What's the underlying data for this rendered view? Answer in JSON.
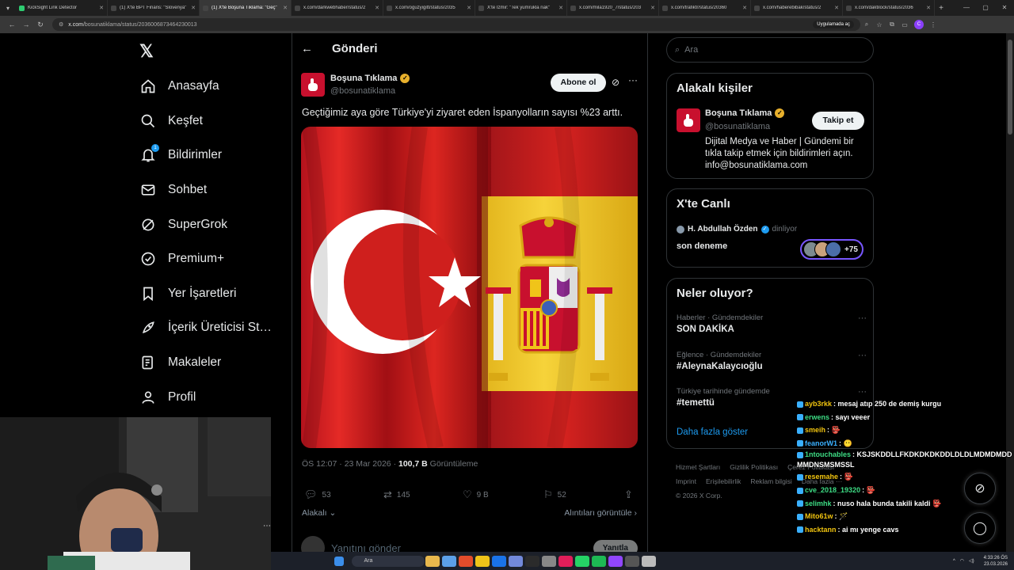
{
  "browser": {
    "tabs": [
      {
        "title": "KickSight Link Detector",
        "color": "#2ecc71"
      },
      {
        "title": "(1) X'te BPT Finans: \"Slovenya\"",
        "color": "#444"
      },
      {
        "title": "(1) X'te Boşuna Tıklama: \"Geç\"",
        "color": "#444",
        "active": true
      },
      {
        "title": "x.com/darkwebhaber/status/2",
        "color": "#444"
      },
      {
        "title": "x.com/oguzyigitt/status/2035",
        "color": "#444"
      },
      {
        "title": "X'te İzmir: \"Tek yumrukla nak\"",
        "color": "#444"
      },
      {
        "title": "x.com/mila1920_7/status/203",
        "color": "#444"
      },
      {
        "title": "x.com/trafiktr/status/20360",
        "color": "#444"
      },
      {
        "title": "x.com/haberebibak/status/2",
        "color": "#444"
      },
      {
        "title": "x.com/daktilock/status/2036",
        "color": "#444"
      }
    ],
    "url_host": "x.com",
    "url_path": "/bosunatiklama/status/2036006873464230013",
    "app_pill": "Uygulamada aç",
    "profile_initial": "C"
  },
  "nav": {
    "items": [
      {
        "label": "Anasayfa",
        "icon": "home-icon"
      },
      {
        "label": "Keşfet",
        "icon": "search-icon"
      },
      {
        "label": "Bildirimler",
        "icon": "bell-icon",
        "badge": "1"
      },
      {
        "label": "Sohbet",
        "icon": "mail-icon"
      },
      {
        "label": "SuperGrok",
        "icon": "grok-icon"
      },
      {
        "label": "Premium+",
        "icon": "verified-icon"
      },
      {
        "label": "Yer İşaretleri",
        "icon": "bookmark-icon"
      },
      {
        "label": "İçerik Üreticisi St…",
        "icon": "rocket-icon"
      },
      {
        "label": "Makaleler",
        "icon": "article-icon"
      },
      {
        "label": "Profil",
        "icon": "person-icon"
      }
    ]
  },
  "post": {
    "header": "Gönderi",
    "author_name": "Boşuna Tıklama",
    "author_handle": "@bosunatiklama",
    "subscribe_label": "Abone ol",
    "text": "Geçtiğimiz aya göre Türkiye'yi ziyaret eden İspanyolların sayısı %23 arttı.",
    "timestamp": "ÖS 12:07 · 23 Mar 2026 · ",
    "views_value": "100,7 B",
    "views_label": " Görüntüleme",
    "replies": "53",
    "reposts": "145",
    "likes": "9 B",
    "bookmarks": "52",
    "relevant_label": "Alakalı",
    "quotes_label": "Alıntıları görüntüle",
    "reply_placeholder": "Yanıtını gönder",
    "reply_button": "Yanıtla"
  },
  "sidebar": {
    "search_placeholder": "Ara",
    "relevant_title": "Alakalı kişiler",
    "rp_name": "Boşuna Tıklama",
    "rp_handle": "@bosunatiklama",
    "follow_label": "Takip et",
    "rp_bio": "Dijital Medya ve Haber | Gündemi bir tıkla takip etmek için bildirimleri açın. info@bosunatiklama.com",
    "live_title": "X'te Canlı",
    "live_host": "H. Abdullah Özden",
    "live_status": "dinliyor",
    "live_space": "son deneme",
    "live_count": "+75",
    "trends_title": "Neler oluyor?",
    "trends": [
      {
        "context": "Haberler · Gündemdekiler",
        "name": "SON DAKİKA"
      },
      {
        "context": "Eğlence · Gündemdekiler",
        "name": "#AleynaKalaycıoğlu"
      },
      {
        "context": "Türkiye tarihinde gündemde",
        "name": "#temettü"
      }
    ],
    "show_more": "Daha fazla göster",
    "footer": [
      "Hizmet Şartları",
      "Gizlilik Politikası",
      "Çerez Politikası",
      "Imprint",
      "Erişilebilirlik",
      "Reklam bilgisi",
      "Daha fazla ···",
      "© 2026 X Corp."
    ]
  },
  "chat": [
    {
      "user": "ayb3rkk",
      "color": "#f1c40f",
      "msg": "mesaj atıp 250 de demiş kurgu"
    },
    {
      "user": "erwens",
      "color": "#3ddc84",
      "msg": "sayı veeer"
    },
    {
      "user": "smeih",
      "color": "#f1c40f",
      "msg": "👺"
    },
    {
      "user": "feanorW1",
      "color": "#3ab0ff",
      "msg": "😶"
    },
    {
      "user": "1ntouchables",
      "color": "#3ddc84",
      "msg": "KSJSKDDLLFKDKDKDKDDLDLDLMDMDMDDMMDNSMSMSSL"
    },
    {
      "user": "resemahe",
      "color": "#f1c40f",
      "msg": "👺"
    },
    {
      "user": "cve_2018_19320",
      "color": "#3ddc84",
      "msg": "👺"
    },
    {
      "user": "selimhk",
      "color": "#3ddc84",
      "msg": "nuso hala bunda takili kaldi 👺"
    },
    {
      "user": "Mito61w",
      "color": "#f1c40f",
      "msg": "🪄"
    },
    {
      "user": "hacktann",
      "color": "#f1c40f",
      "msg": "ai mı yenge cavs"
    }
  ],
  "taskbar": {
    "search_label": "Ara",
    "time": "4:33:26 ÖS",
    "date": "23.03.2026"
  }
}
